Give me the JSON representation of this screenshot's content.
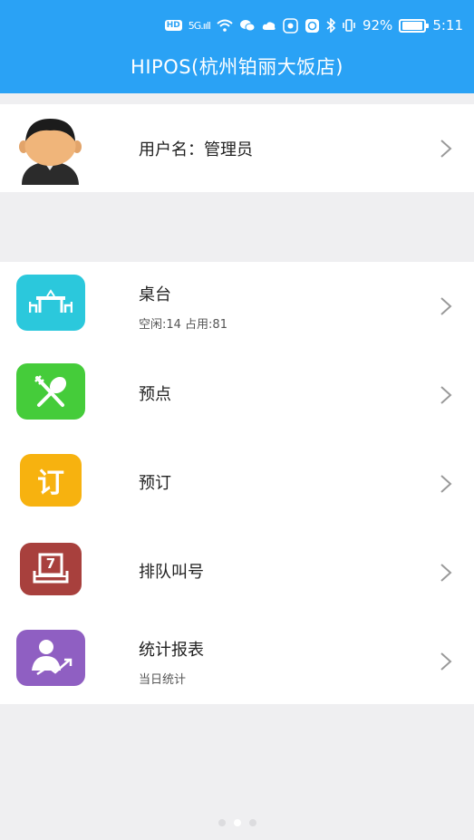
{
  "status_bar": {
    "hd": "HD",
    "signal": "5G.ııll",
    "battery": "92%",
    "battery_level": 0.92,
    "time": "5:11"
  },
  "header": {
    "title": "HIPOS(杭州铂丽大饭店)"
  },
  "user": {
    "label": "用户名：管理员",
    "avatar_icon": "user-avatar-icon"
  },
  "menu": {
    "items": [
      {
        "label": "桌台",
        "sub": "空闲:14 占用:81",
        "icon": "table-icon",
        "color": "#2bc8dc"
      },
      {
        "label": "预点",
        "sub": "",
        "icon": "fork-spoon-icon",
        "color": "#45cc3a"
      },
      {
        "label": "预订",
        "sub": "",
        "icon": "reserve-icon",
        "icon_text": "订",
        "color": "#f7b20f"
      },
      {
        "label": "排队叫号",
        "sub": "",
        "icon": "queue-ticket-icon",
        "icon_text": "7",
        "color": "#a8403d"
      },
      {
        "label": "统计报表",
        "sub": "当日统计",
        "icon": "report-chart-icon",
        "color": "#8f5fc2"
      }
    ]
  },
  "pager": {
    "pages": 3,
    "active": 1
  },
  "colors": {
    "primary": "#2aa2f5",
    "background": "#efeff1"
  }
}
